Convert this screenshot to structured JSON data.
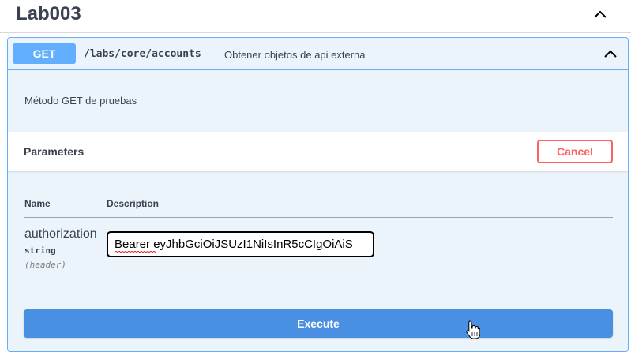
{
  "tag": {
    "title": "Lab003",
    "toggle_icon": "chevron-up-icon"
  },
  "operation": {
    "method": "GET",
    "path": "/labs/core/accounts",
    "summary": "Obtener objetos de api externa",
    "toggle_icon": "chevron-up-icon",
    "description": "Método GET de pruebas",
    "colors": {
      "method_bg": "#61affe",
      "block_bg": "#ebf3fb",
      "cancel": "#ff6060",
      "execute": "#4990e2"
    }
  },
  "parameters": {
    "title": "Parameters",
    "cancel_label": "Cancel",
    "columns": {
      "name": "Name",
      "description": "Description"
    },
    "items": [
      {
        "name": "authorization",
        "type": "string",
        "in": "(header)",
        "value": "Bearer eyJhbGciOiJSUzI1NiIsInR5cCIgOiAiS"
      }
    ]
  },
  "execute_label": "Execute",
  "cursor_icon": "hand-pointer-icon"
}
